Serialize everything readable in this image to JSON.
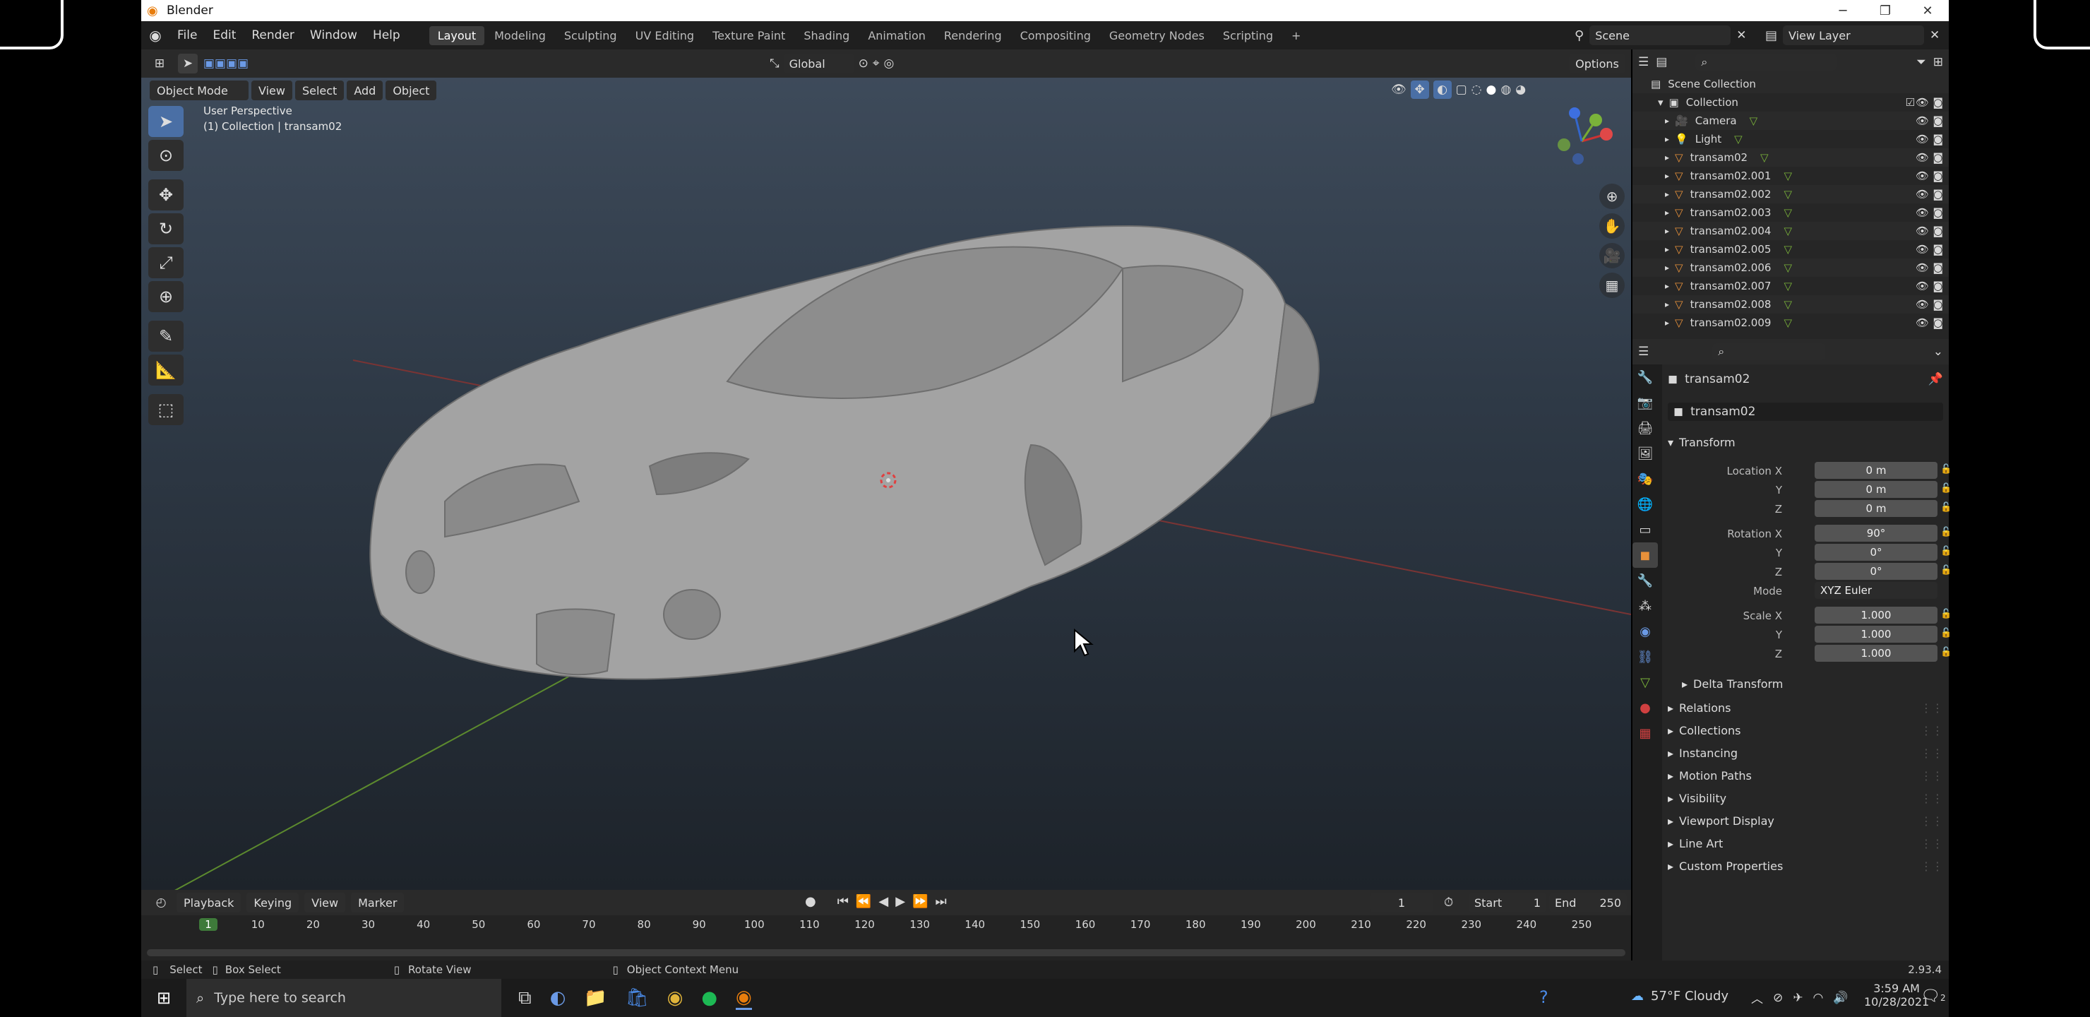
{
  "window": {
    "title": "Blender"
  },
  "topbar": {
    "menus": [
      "File",
      "Edit",
      "Render",
      "Window",
      "Help"
    ],
    "workspaces": [
      "Layout",
      "Modeling",
      "Sculpting",
      "UV Editing",
      "Texture Paint",
      "Shading",
      "Animation",
      "Rendering",
      "Compositing",
      "Geometry Nodes",
      "Scripting"
    ],
    "active_workspace": "Layout",
    "scene": "Scene",
    "view_layer": "View Layer"
  },
  "tool_header": {
    "orientation": "Global",
    "options_label": "Options"
  },
  "viewport": {
    "mode": "Object Mode",
    "menus": [
      "View",
      "Select",
      "Add",
      "Object"
    ],
    "perspective_label": "User Perspective",
    "collection_label": "(1) Collection | transam02"
  },
  "outliner": {
    "scene_collection": "Scene Collection",
    "collection": "Collection",
    "items": [
      "Camera",
      "Light",
      "transam02",
      "transam02.001",
      "transam02.002",
      "transam02.003",
      "transam02.004",
      "transam02.005",
      "transam02.006",
      "transam02.007",
      "transam02.008",
      "transam02.009"
    ]
  },
  "properties": {
    "object_name": "transam02",
    "data_name": "transam02",
    "transform_header": "Transform",
    "location_label": "Location X",
    "rotation_label": "Rotation X",
    "scale_label": "Scale X",
    "y_label": "Y",
    "z_label": "Z",
    "mode_label": "Mode",
    "location": [
      "0 m",
      "0 m",
      "0 m"
    ],
    "rotation": [
      "90°",
      "0°",
      "0°"
    ],
    "mode": "XYZ Euler",
    "scale": [
      "1.000",
      "1.000",
      "1.000"
    ],
    "delta_transform": "Delta Transform",
    "panels": [
      "Relations",
      "Collections",
      "Instancing",
      "Motion Paths",
      "Visibility",
      "Viewport Display",
      "Line Art",
      "Custom Properties"
    ]
  },
  "timeline": {
    "menus": [
      "Playback",
      "Keying",
      "View",
      "Marker"
    ],
    "current_frame": "1",
    "start_label": "Start",
    "start": "1",
    "end_label": "End",
    "end": "250",
    "ticks": [
      "1",
      "10",
      "20",
      "30",
      "40",
      "50",
      "60",
      "70",
      "80",
      "90",
      "100",
      "110",
      "120",
      "130",
      "140",
      "150",
      "160",
      "170",
      "180",
      "190",
      "200",
      "210",
      "220",
      "230",
      "240",
      "250"
    ]
  },
  "statusbar": {
    "select": "Select",
    "box_select": "Box Select",
    "rotate_view": "Rotate View",
    "context_menu": "Object Context Menu",
    "version": "2.93.4"
  },
  "taskbar": {
    "search_placeholder": "Type here to search",
    "weather": "57°F Cloudy",
    "time": "3:59 AM",
    "date": "10/28/2021",
    "notification_count": "2"
  }
}
